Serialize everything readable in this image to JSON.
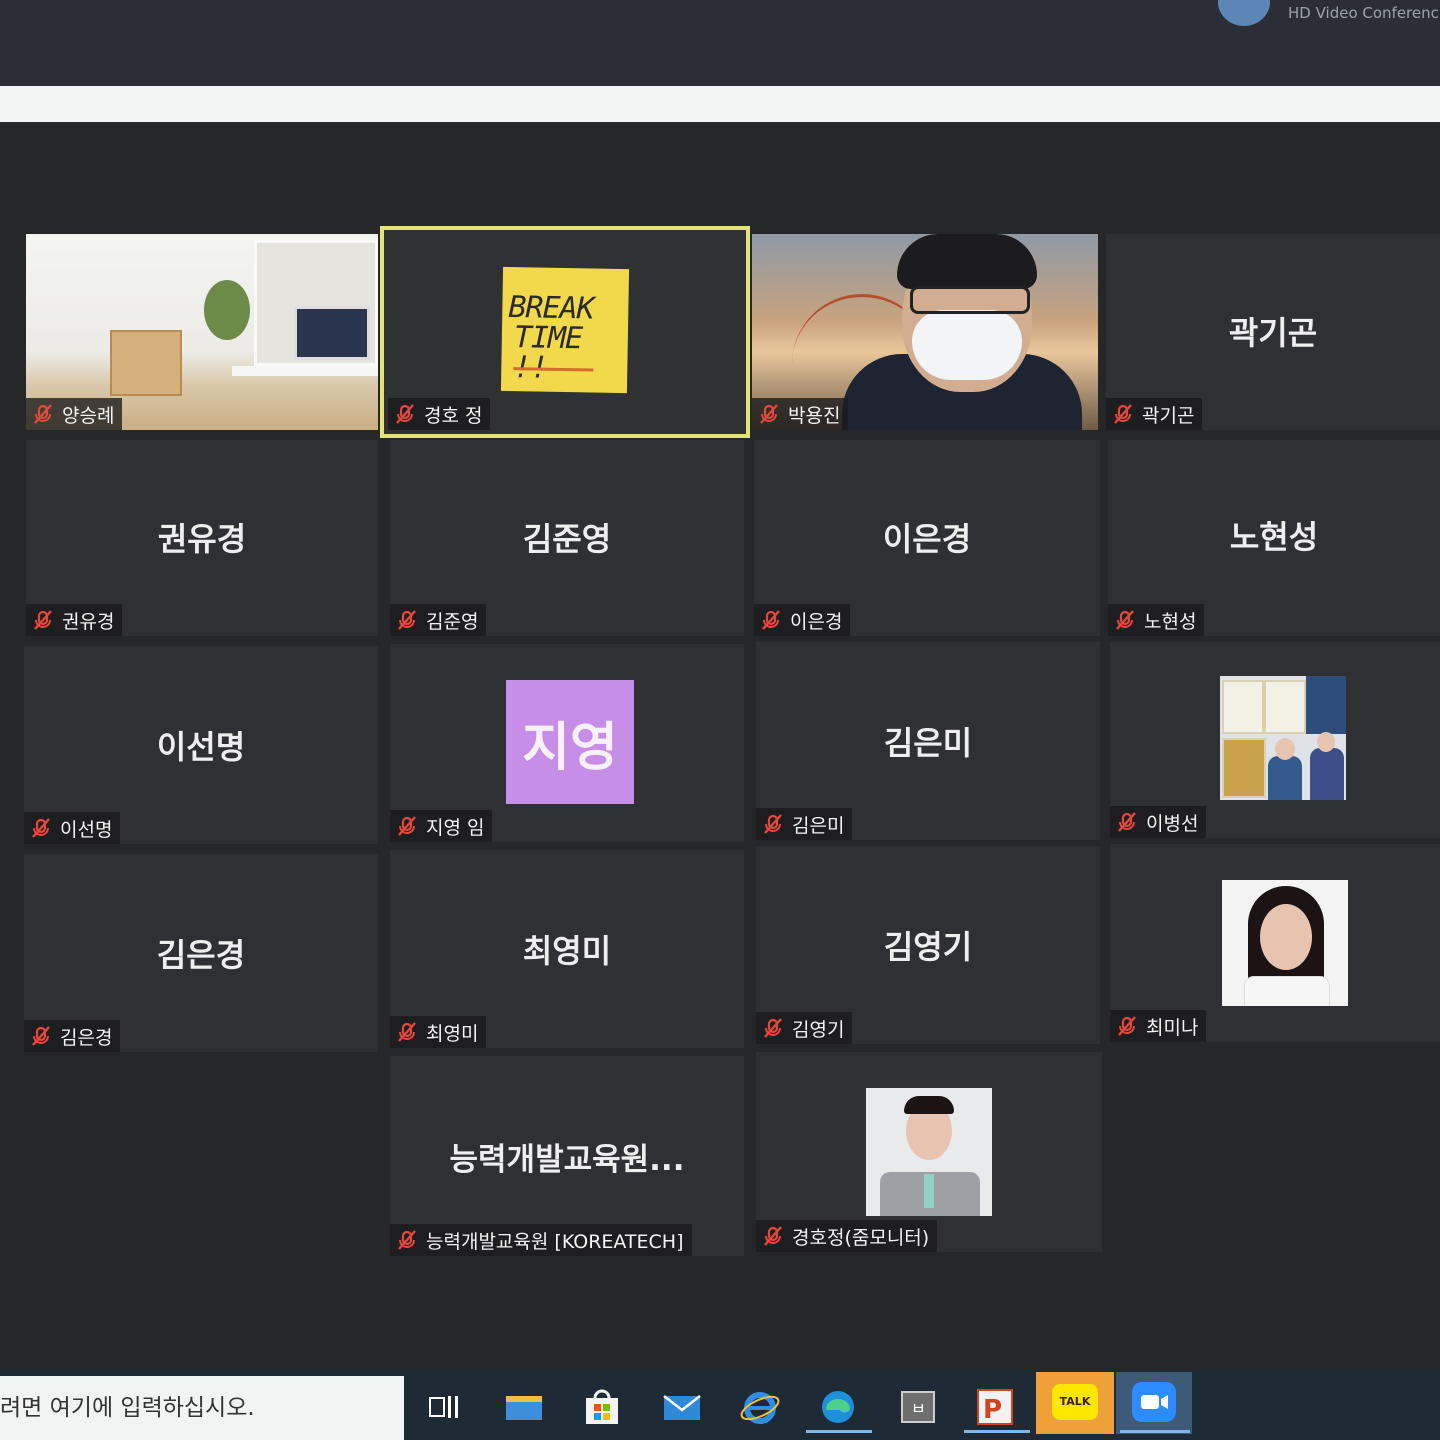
{
  "app": {
    "title": "HD Video Conferencing"
  },
  "participants": [
    {
      "label": "양승례"
    },
    {
      "label": "경호 정"
    },
    {
      "label": "박용진"
    },
    {
      "label": "곽기곤",
      "display": "곽기곤"
    },
    {
      "label": "권유경",
      "display": "권유경"
    },
    {
      "label": "김준영",
      "display": "김준영"
    },
    {
      "label": "이은경",
      "display": "이은경"
    },
    {
      "label": "노현성",
      "display": "노현성"
    },
    {
      "label": "이선명",
      "display": "이선명"
    },
    {
      "label": "지영 임",
      "avatar": "지영",
      "avatar_color": "#c78ee8"
    },
    {
      "label": "김은미",
      "display": "김은미"
    },
    {
      "label": "이병선"
    },
    {
      "label": "김은경",
      "display": "김은경"
    },
    {
      "label": "최영미",
      "display": "최영미"
    },
    {
      "label": "김영기",
      "display": "김영기"
    },
    {
      "label": "최미나"
    },
    {
      "label": "능력개발교육원 [KOREATECH]",
      "display": "능력개발교육원..."
    },
    {
      "label": "경호정(줌모니터)"
    }
  ],
  "break_note": {
    "line1": "BREAK",
    "line2": "TIME !!"
  },
  "active_speaker_color": "#e4e37a",
  "taskbar": {
    "search_placeholder": "려면 여기에 입력하십시오.",
    "apps": [
      "task-view-icon",
      "file-explorer-icon",
      "store-icon",
      "mail-icon",
      "ie-icon",
      "edge-icon",
      "app-icon",
      "powerpoint-icon",
      "kakaotalk-icon",
      "zoom-icon"
    ],
    "app_badge": "ㅂ",
    "kakaotalk_label": "TALK"
  }
}
